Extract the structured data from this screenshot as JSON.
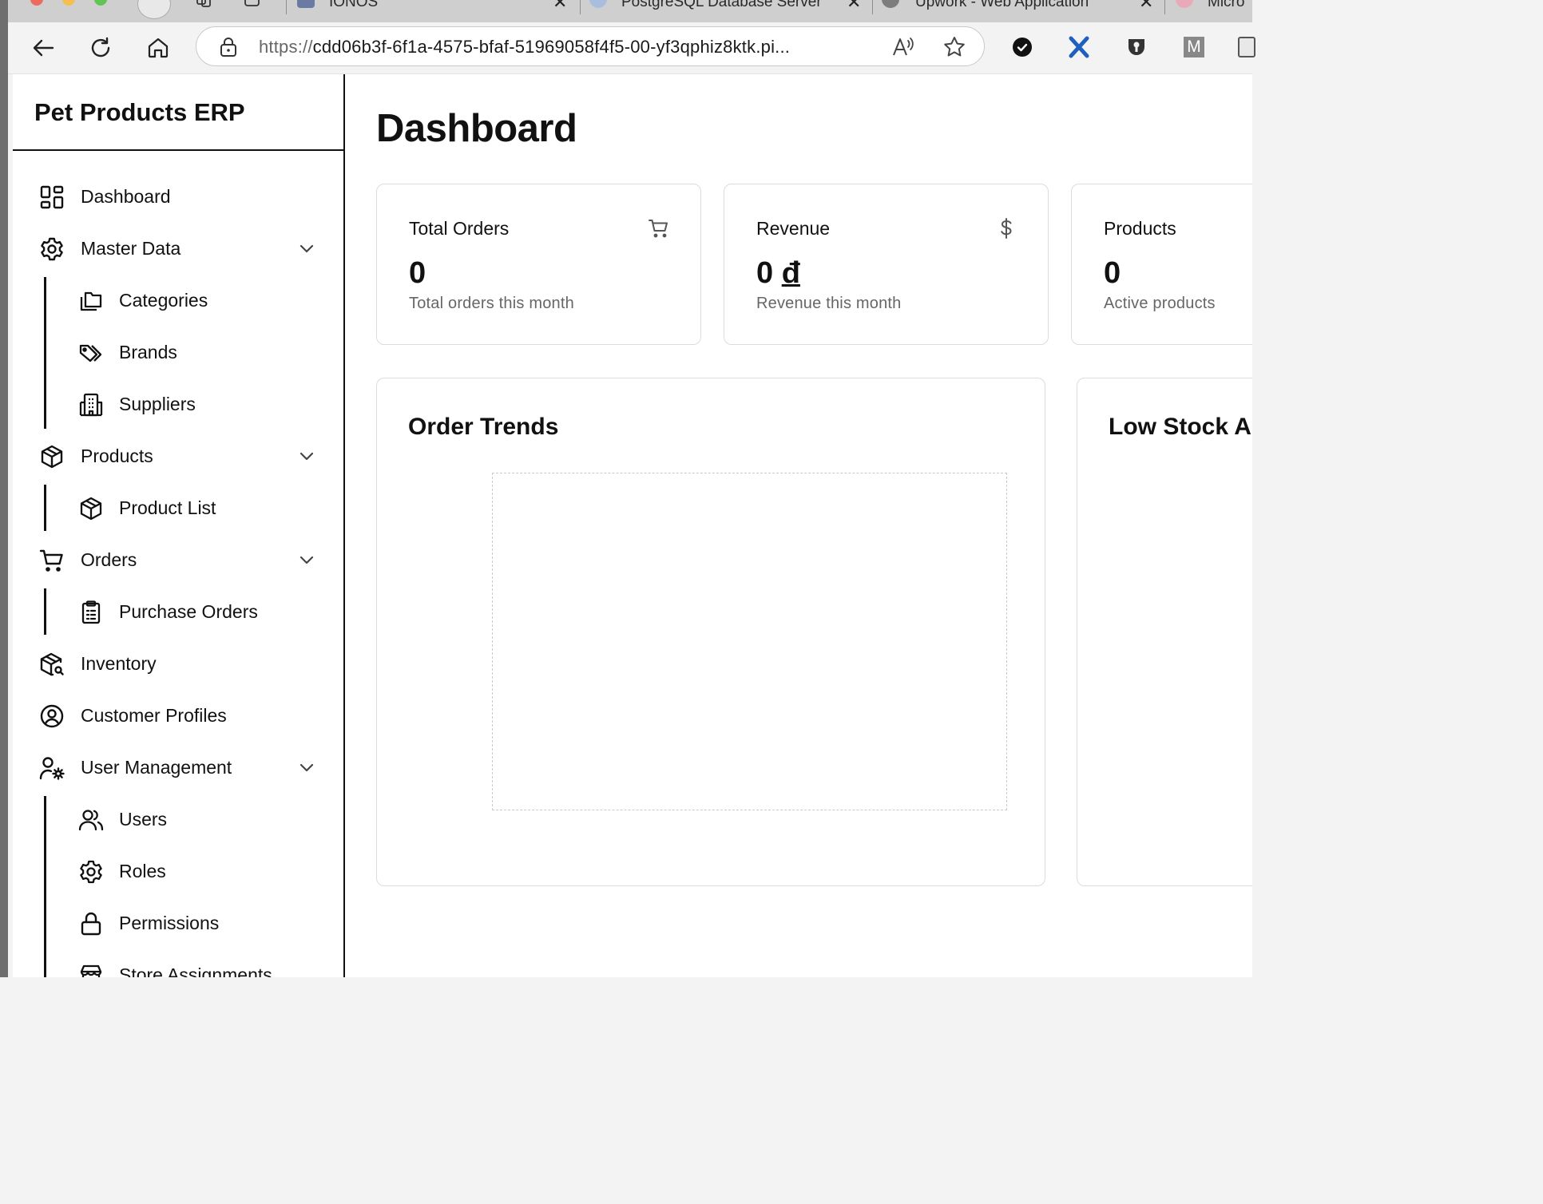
{
  "browser": {
    "tabs": [
      {
        "title": "IONOS"
      },
      {
        "title": "PostgreSQL Database Server"
      },
      {
        "title": "Upwork - Web Application"
      },
      {
        "title": "Micro"
      }
    ],
    "address": {
      "scheme": "https://",
      "rest": "cdd06b3f-6f1a-4575-bfaf-51969058f4f5-00-yf3qphiz8ktk.pi..."
    },
    "extensions": [
      {
        "name": "checkmark-circle-icon"
      },
      {
        "name": "x-logo-icon"
      },
      {
        "name": "shield-key-icon"
      },
      {
        "name": "M"
      },
      {
        "name": "document-icon"
      }
    ]
  },
  "sidebar": {
    "brand": "Pet Products ERP",
    "items": [
      {
        "label": "Dashboard",
        "icon": "grid-icon"
      },
      {
        "label": "Master Data",
        "icon": "gear-icon",
        "expanded": true,
        "children": [
          {
            "label": "Categories",
            "icon": "folders-icon"
          },
          {
            "label": "Brands",
            "icon": "tags-icon"
          },
          {
            "label": "Suppliers",
            "icon": "building-icon"
          }
        ]
      },
      {
        "label": "Products",
        "icon": "box-icon",
        "expanded": true,
        "children": [
          {
            "label": "Product List",
            "icon": "box-icon"
          }
        ]
      },
      {
        "label": "Orders",
        "icon": "cart-icon",
        "expanded": true,
        "children": [
          {
            "label": "Purchase Orders",
            "icon": "clipboard-icon"
          }
        ]
      },
      {
        "label": "Inventory",
        "icon": "package-search-icon"
      },
      {
        "label": "Customer Profiles",
        "icon": "user-circle-icon"
      },
      {
        "label": "User Management",
        "icon": "user-cog-icon",
        "expanded": true,
        "children": [
          {
            "label": "Users",
            "icon": "users-icon"
          },
          {
            "label": "Roles",
            "icon": "gear-icon"
          },
          {
            "label": "Permissions",
            "icon": "lock-icon"
          },
          {
            "label": "Store Assignments",
            "icon": "store-icon"
          }
        ]
      }
    ]
  },
  "main": {
    "title": "Dashboard",
    "stats": [
      {
        "title": "Total Orders",
        "value": "0",
        "currency": "",
        "subtitle": "Total orders this month",
        "icon": "cart-icon"
      },
      {
        "title": "Revenue",
        "value": "0",
        "currency": "đ",
        "subtitle": "Revenue this month",
        "icon": "dollar-icon"
      },
      {
        "title": "Products",
        "value": "0",
        "currency": "",
        "subtitle": "Active products",
        "icon": "box-icon"
      }
    ],
    "panels": [
      {
        "title": "Order Trends"
      },
      {
        "title": "Low Stock Alerts"
      }
    ]
  },
  "colors": {
    "text": "#111111",
    "muted": "#666666",
    "border": "#dcdcdc",
    "chrome": "#f3f3f3"
  }
}
